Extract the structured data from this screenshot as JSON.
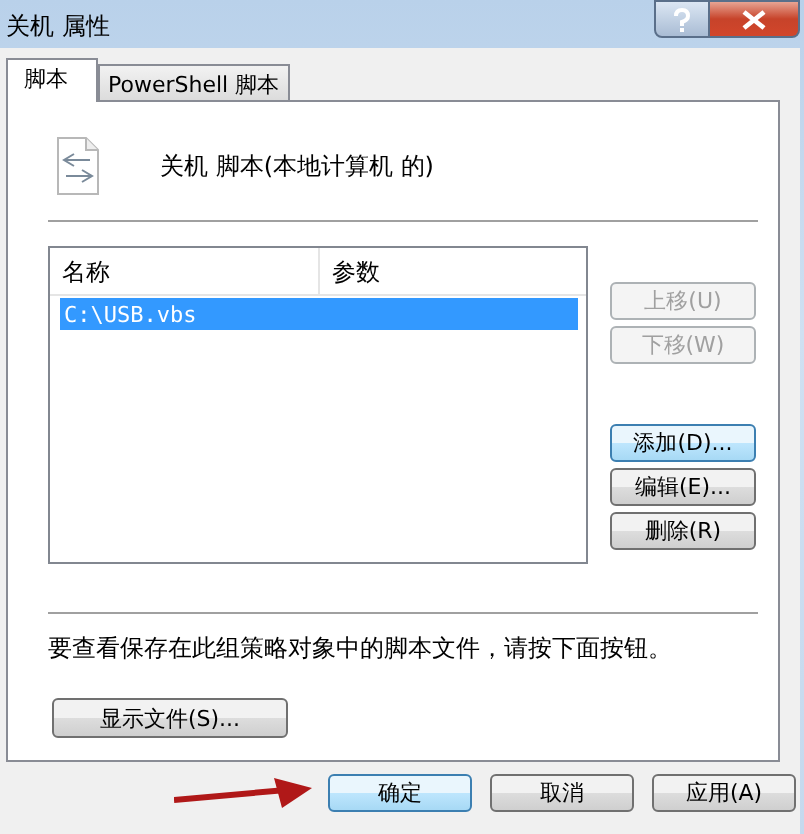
{
  "window": {
    "title": "关机 属性"
  },
  "tabs": [
    {
      "label": "脚本",
      "selected": true
    },
    {
      "label": "PowerShell 脚本",
      "selected": false
    }
  ],
  "heading": "关机 脚本(本地计算机 的)",
  "table": {
    "columns": [
      "名称",
      "参数"
    ],
    "rows": [
      {
        "cells": [
          "C:\\USB.vbs",
          ""
        ],
        "selected": true
      }
    ]
  },
  "side_buttons": [
    {
      "label": "上移(U)",
      "disabled": true,
      "focused": false
    },
    {
      "label": "下移(W)",
      "disabled": true,
      "focused": false
    },
    {
      "label": "添加(D)...",
      "disabled": false,
      "focused": true
    },
    {
      "label": "编辑(E)...",
      "disabled": false,
      "focused": false
    },
    {
      "label": "删除(R)",
      "disabled": false,
      "focused": false
    }
  ],
  "hint": "要查看保存在此组策略对象中的脚本文件，请按下面按钮。",
  "show_files_button": "显示文件(S)...",
  "buttons": [
    {
      "label": "确定",
      "focused": true
    },
    {
      "label": "取消",
      "focused": false
    },
    {
      "label": "应用(A)",
      "focused": false
    }
  ]
}
